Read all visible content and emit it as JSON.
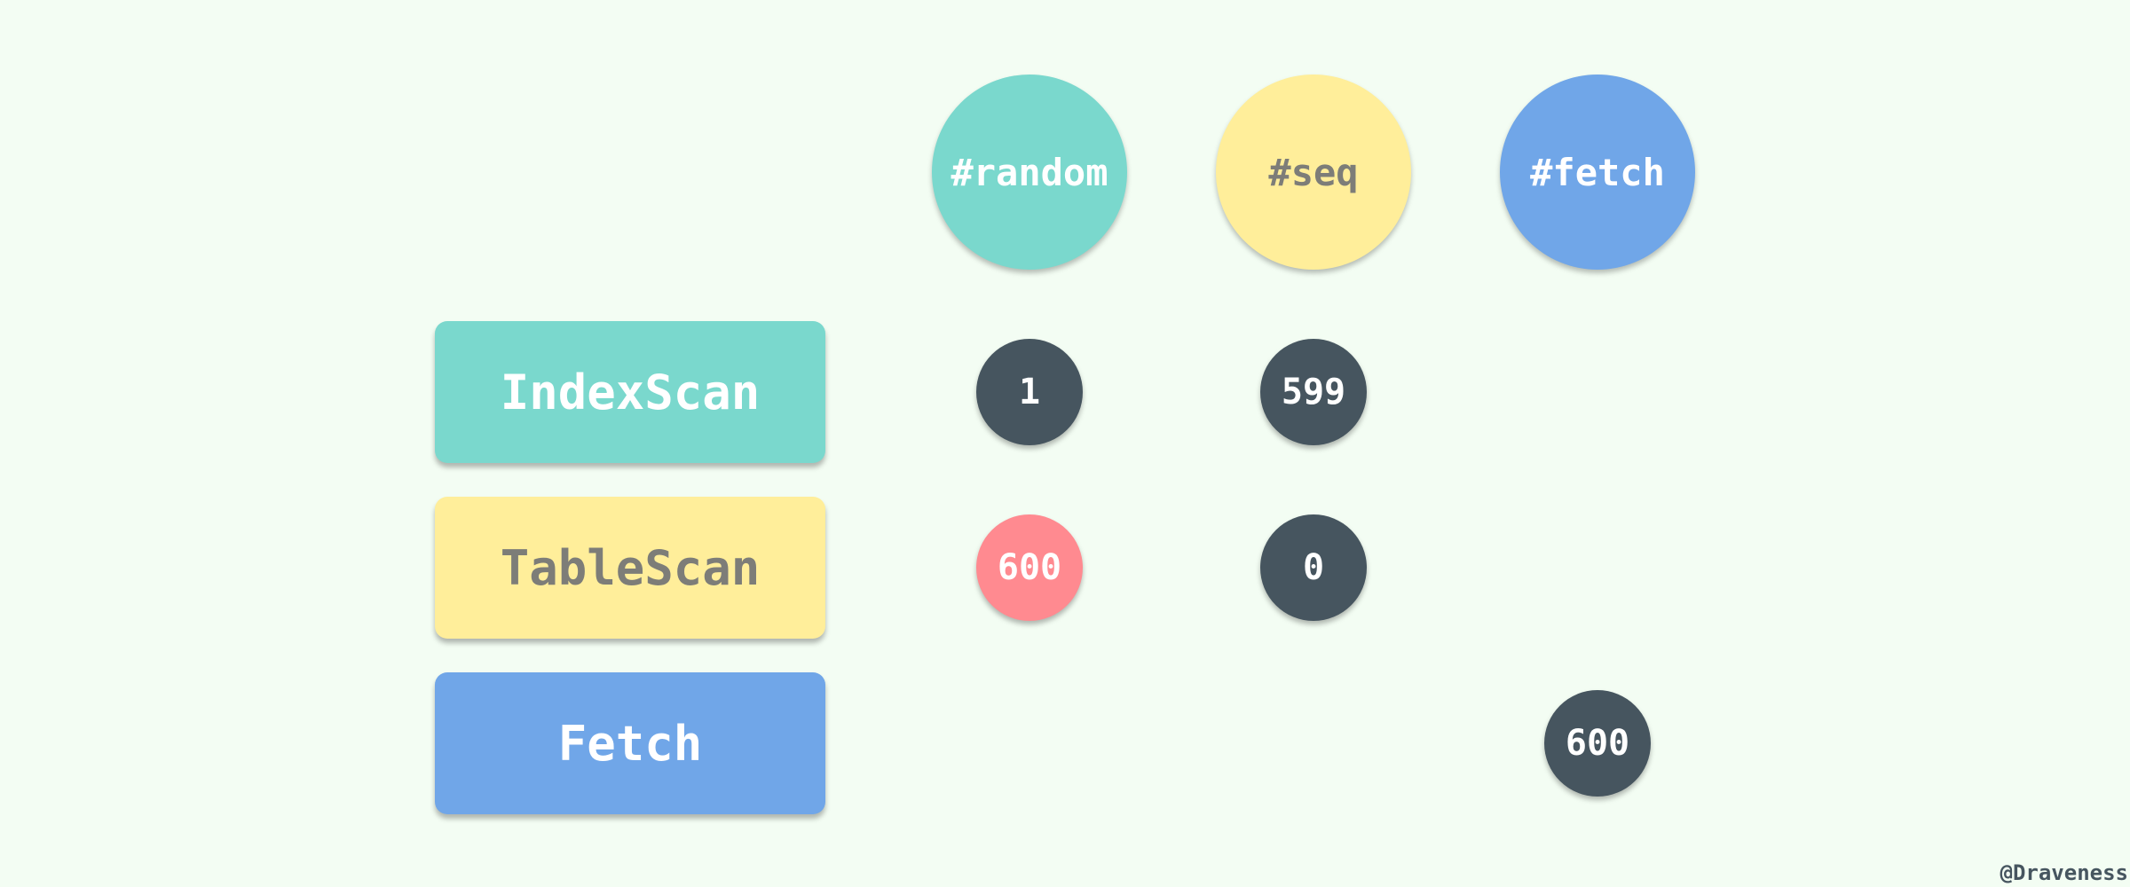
{
  "columns": {
    "random": "#random",
    "seq": "#seq",
    "fetch": "#fetch"
  },
  "rows": {
    "index_scan": {
      "label": "IndexScan",
      "random": "1",
      "seq": "599"
    },
    "table_scan": {
      "label": "TableScan",
      "random": "600",
      "seq": "0"
    },
    "fetch": {
      "label": "Fetch",
      "fetch": "600"
    }
  },
  "credit": "@Draveness",
  "colors": {
    "background": "#f3fdf3",
    "teal": "#7ad8cd",
    "yellow": "#ffee9a",
    "blue": "#70a6e8",
    "dark": "#46555f",
    "highlight": "#ff8a90"
  }
}
